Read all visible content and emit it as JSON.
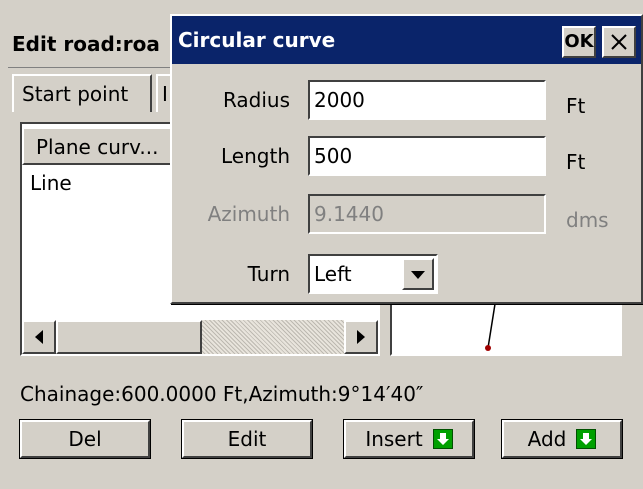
{
  "window": {
    "title": "Edit road:roa",
    "tabs": [
      "Start point",
      "I"
    ],
    "list": {
      "header": "Plane curv...",
      "rows": [
        "Line"
      ]
    },
    "status": "Chainage:600.0000 Ft,Azimuth:9°14′40″",
    "buttons": {
      "del": "Del",
      "edit": "Edit",
      "insert": "Insert",
      "add": "Add"
    }
  },
  "dialog": {
    "title": "Circular curve",
    "ok_label": "OK",
    "close_glyph": "✕",
    "fields": {
      "radius": {
        "label": "Radius",
        "value": "2000",
        "unit": "Ft"
      },
      "length": {
        "label": "Length",
        "value": "500",
        "unit": "Ft"
      },
      "azimuth": {
        "label": "Azimuth",
        "value": "9.1440",
        "unit": "dms"
      },
      "turn": {
        "label": "Turn",
        "value": "Left"
      }
    }
  },
  "colors": {
    "titlebar": "#0a246a",
    "face": "#d4d0c8",
    "arrow_icon": "#00a000",
    "preview_point": "#a00000"
  },
  "icons": {
    "scroll_left": "triangle-left",
    "scroll_right": "triangle-right",
    "dropdown": "triangle-down",
    "insert_arrow": "arrow-down-green",
    "add_arrow": "arrow-down-green"
  }
}
